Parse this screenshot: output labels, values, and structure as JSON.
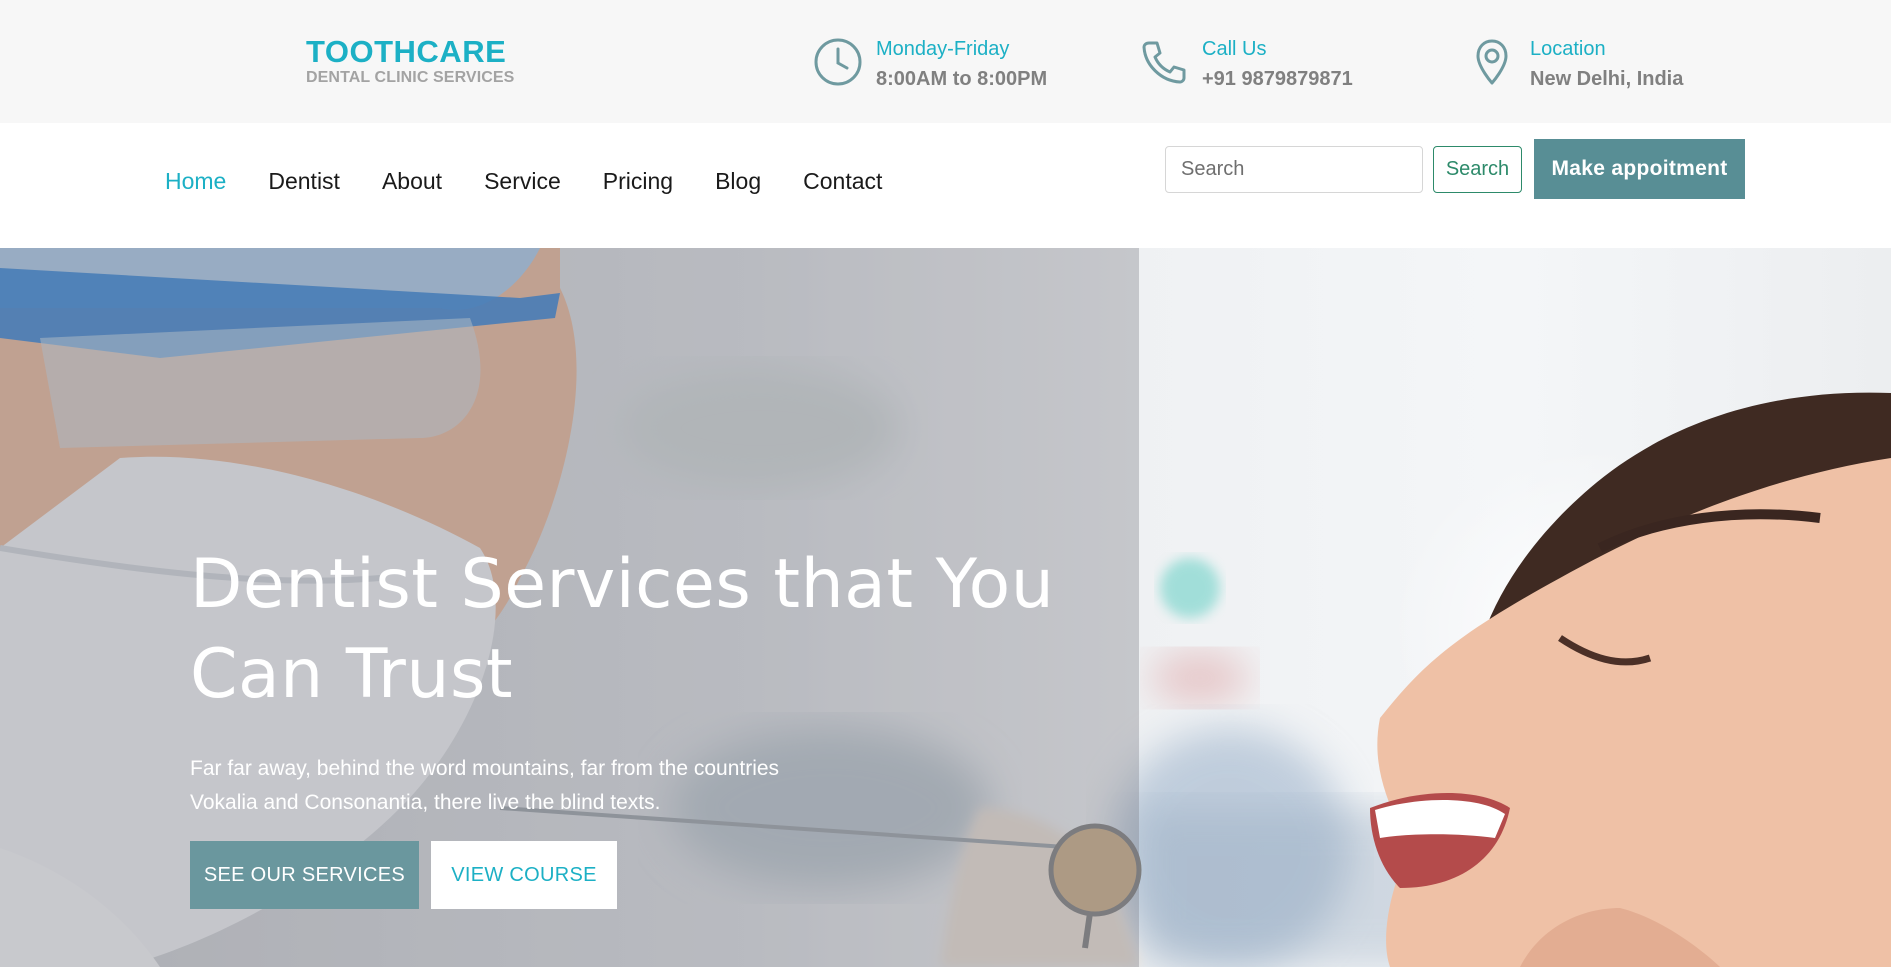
{
  "brand": {
    "title": "TOOTHCARE",
    "subtitle": "DENTAL CLINIC SERVICES"
  },
  "info": {
    "hours": {
      "icon": "clock-icon",
      "label": "Monday-Friday",
      "value": "8:00AM to 8:00PM"
    },
    "call": {
      "icon": "phone-icon",
      "label": "Call Us",
      "value": "+91 9879879871"
    },
    "location": {
      "icon": "map-pin-icon",
      "label": "Location",
      "value": "New Delhi, India"
    }
  },
  "nav": {
    "items": [
      {
        "label": "Home",
        "active": true
      },
      {
        "label": "Dentist"
      },
      {
        "label": "About"
      },
      {
        "label": "Service"
      },
      {
        "label": "Pricing"
      },
      {
        "label": "Blog"
      },
      {
        "label": "Contact"
      }
    ]
  },
  "search": {
    "placeholder": "Search",
    "button_label": "Search"
  },
  "appointment": {
    "label": "Make appoitment"
  },
  "hero": {
    "title": "Dentist Services that You Can Trust",
    "text": "Far far away, behind the word mountains, far from the countries Vokalia and Consonantia, there live the blind texts.",
    "primary_button": "SEE OUR SERVICES",
    "secondary_button": "VIEW COURSE"
  },
  "colors": {
    "accent": "#1cb0c5",
    "button_teal": "#588e95",
    "search_green": "#2d8a6a",
    "topbar_bg": "#f7f7f7",
    "muted_text": "#808080"
  }
}
